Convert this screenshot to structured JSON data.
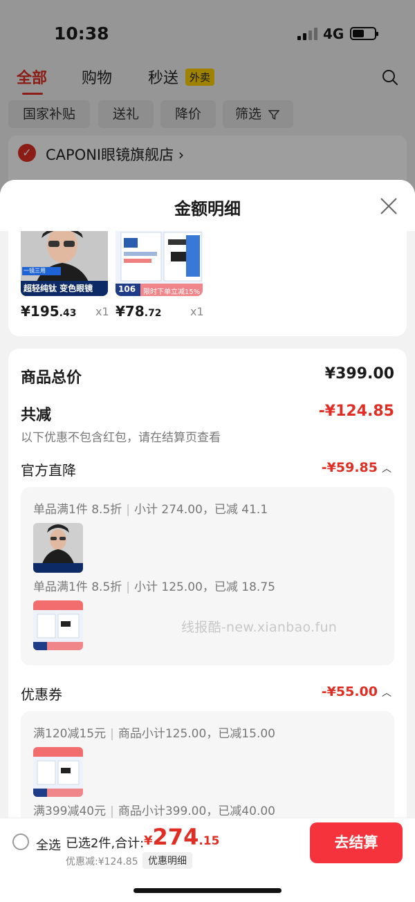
{
  "status_bar": {
    "time": "10:38",
    "network": "4G"
  },
  "top_tabs": [
    {
      "label": "全部",
      "active": true
    },
    {
      "label": "购物",
      "active": false
    },
    {
      "label": "秒送",
      "active": false
    }
  ],
  "waimai_badge": "外卖",
  "filters": [
    "国家补贴",
    "送礼",
    "降价",
    "筛选"
  ],
  "store": {
    "name": "CAPONI眼镜旗舰店"
  },
  "sheet": {
    "title": "金额明细",
    "products": [
      {
        "thumb_tag": "一镜三用",
        "thumb_caption": "超轻纯钛 变色眼镜",
        "price_int": "¥195",
        "price_dec": ".43",
        "qty": "x1"
      },
      {
        "thumb_tag": "106",
        "thumb_caption": "限时下单立减15%",
        "price_int": "¥78",
        "price_dec": ".72",
        "qty": "x1"
      }
    ],
    "goods_total_label": "商品总价",
    "goods_total_value": "¥399.00",
    "total_off_label": "共减",
    "total_off_value": "-¥124.85",
    "total_off_note": "以下优惠不包含红包，请在结算页查看",
    "official": {
      "label": "官方直降",
      "value": "-¥59.85",
      "rules": [
        {
          "a": "单品满1件 8.5折",
          "b": "小计 274.00，已减 41.1"
        },
        {
          "a": "单品满1件 8.5折",
          "b": "小计 125.00，已减 18.75"
        }
      ]
    },
    "coupon": {
      "label": "优惠券",
      "value": "-¥55.00",
      "rules": [
        {
          "a": "满120减15元",
          "b": "商品小计125.00，已减15.00"
        },
        {
          "a": "满399减40元",
          "b": "商品小计399.00，已减40.00"
        }
      ]
    },
    "watermark": "线报酷-new.xianbao.fun"
  },
  "bottom_bar": {
    "select_all": "全选",
    "summary": "已选2件,合计:",
    "total_currency": "¥",
    "total_int": "274",
    "total_dec": ".15",
    "discount": "优惠减:¥124.85",
    "detail_tag": "优惠明细",
    "checkout": "去结算"
  },
  "colors": {
    "accent": "#e02e24",
    "checkout": "#f4333c",
    "badge": "#ffd200"
  }
}
